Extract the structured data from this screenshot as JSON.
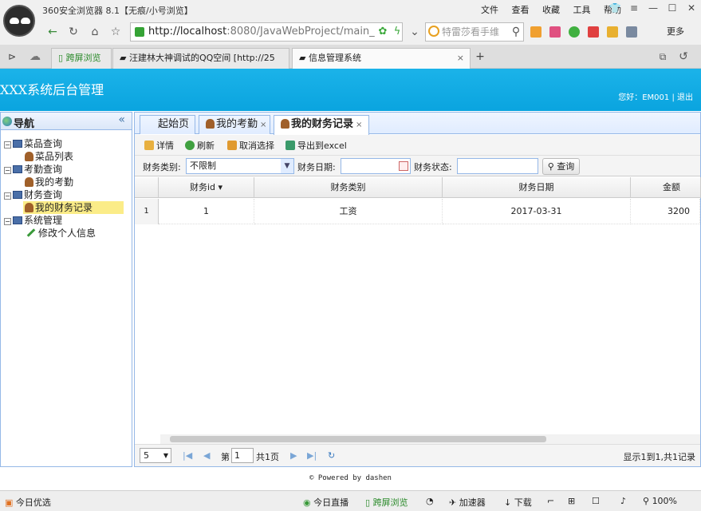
{
  "browser": {
    "title": "360安全浏览器 8.1【无痕/小号浏览】",
    "menu": [
      "文件",
      "查看",
      "收藏",
      "工具",
      "帮助"
    ],
    "url_host": "http://localhost",
    "url_rest": ":8080/JavaWebProject/main_",
    "search_text": "特雷莎看手维",
    "more_label": "更多",
    "tabs": [
      {
        "label": "跨屏浏览"
      },
      {
        "label": "汪建林大神调试的QQ空间 [http://25"
      },
      {
        "label": "信息管理系统"
      }
    ],
    "new_tab": "+"
  },
  "app": {
    "title": "XXX系统后台管理",
    "user_info": "您好：EM001 | 退出"
  },
  "nav": {
    "title": "导航",
    "collapse": "«",
    "tree": [
      {
        "label": "菜品查询",
        "level": 0,
        "toggle": "−"
      },
      {
        "label": "菜品列表",
        "level": 1
      },
      {
        "label": "考勤查询",
        "level": 0,
        "toggle": "−"
      },
      {
        "label": "我的考勤",
        "level": 1
      },
      {
        "label": "财务查询",
        "level": 0,
        "toggle": "−"
      },
      {
        "label": "我的财务记录",
        "level": 1,
        "selected": true
      },
      {
        "label": "系统管理",
        "level": 0,
        "toggle": "−"
      },
      {
        "label": "修改个人信息",
        "level": 1
      }
    ]
  },
  "panel_tabs": [
    {
      "label": "起始页"
    },
    {
      "label": "我的考勤",
      "close": "×"
    },
    {
      "label": "我的财务记录",
      "close": "×",
      "active": true
    }
  ],
  "toolbar": {
    "detail": "详情",
    "refresh": "刷新",
    "unselect": "取消选择",
    "export": "导出到excel"
  },
  "filter": {
    "type_label": "财务类别:",
    "type_value": "不限制",
    "date_label": "财务日期:",
    "state_label": "财务状态:",
    "query": "查询"
  },
  "grid": {
    "columns": [
      "财务id ▾",
      "财务类别",
      "财务日期",
      "金额"
    ],
    "rows": [
      {
        "num": "1",
        "id": "1",
        "type": "工资",
        "date": "2017-03-31",
        "amount": "3200"
      }
    ]
  },
  "pager": {
    "page_size": "5",
    "page_prefix": "第",
    "page_value": "1",
    "page_total": "共1页",
    "summary": "显示1到1,共1记录"
  },
  "footer": "© Powered by dashen",
  "status": {
    "left": "今日优选",
    "live": "今日直播",
    "cross": "跨屏浏览",
    "accel": "加速器",
    "download": "下载",
    "zoom": "100%"
  }
}
